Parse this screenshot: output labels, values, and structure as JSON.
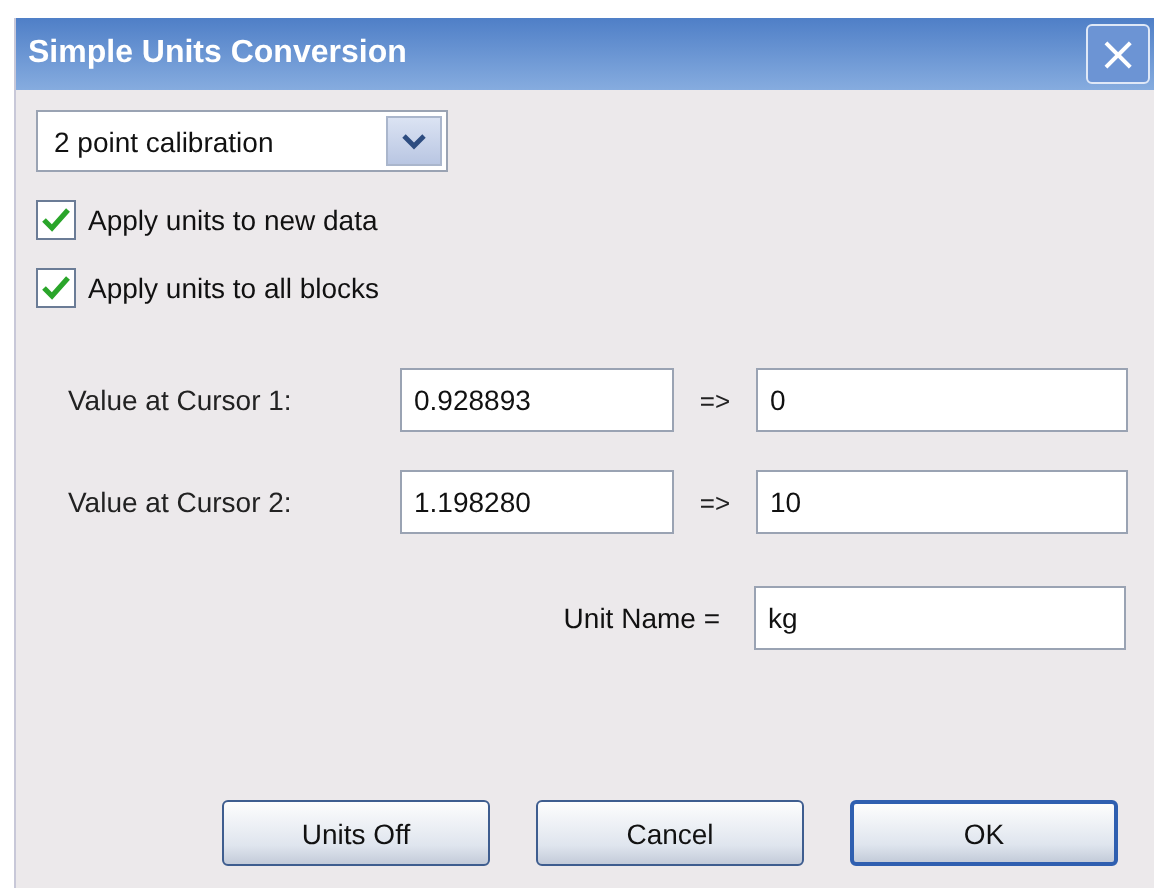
{
  "window": {
    "title": "Simple Units Conversion",
    "close": "×"
  },
  "mode_dropdown": {
    "value": "2 point calibration"
  },
  "checkboxes": [
    {
      "label": "Apply units to new data",
      "checked": true
    },
    {
      "label": "Apply units to all blocks",
      "checked": true
    }
  ],
  "cursor_rows": [
    {
      "label": "Value at Cursor 1:",
      "value": "0.928893",
      "arrow": "=>",
      "target": "0"
    },
    {
      "label": "Value at Cursor 2:",
      "value": "1.198280",
      "arrow": "=>",
      "target": "10"
    }
  ],
  "unit_name": {
    "label": "Unit Name =",
    "value": "kg"
  },
  "buttons": [
    {
      "label": "Units Off",
      "default": false
    },
    {
      "label": "Cancel",
      "default": false
    },
    {
      "label": "OK",
      "default": true
    }
  ]
}
